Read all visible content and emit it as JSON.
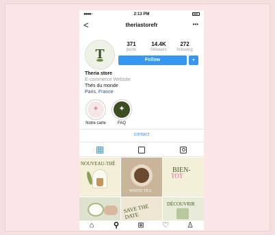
{
  "status_bar": {
    "signal": "●●●●○",
    "time": "2:13 PM"
  },
  "header": {
    "back_icon": "chevron-left-icon",
    "back": "<",
    "username": "theriastorefr",
    "more_icon": "more-icon",
    "more": "•••"
  },
  "profile": {
    "avatar_monogram": "T",
    "stats": [
      {
        "value": "371",
        "label": "posts"
      },
      {
        "value": "14.4K",
        "label": "followers"
      },
      {
        "value": "272",
        "label": "following"
      }
    ],
    "follow_button": "Follow",
    "dropdown_icon": "▾",
    "accent": "#3897f0"
  },
  "bio": {
    "name": "Theria store",
    "category": "E-commerce Website",
    "tagline": "Thés du monde",
    "location": "Paris, France"
  },
  "highlights": [
    {
      "label": "Notre carte",
      "icon": "✦"
    },
    {
      "label": "FAQ",
      "icon": "✦"
    }
  ],
  "contact_button": "contact",
  "tabs": [
    {
      "name": "grid-icon",
      "active": true
    },
    {
      "name": "feed-icon",
      "active": false
    },
    {
      "name": "tagged-icon",
      "active": false
    }
  ],
  "posts": [
    {
      "text": "NOUVEAU-THÉ"
    },
    {
      "text": "WHITE TEA"
    },
    {
      "text": "BIEN-",
      "text2": "TOT"
    },
    {
      "text": ""
    },
    {
      "text": "SAVE THE DATE"
    },
    {
      "text": "DÉCOUVRIR"
    }
  ],
  "bottom_nav": [
    {
      "name": "home-icon",
      "glyph": "⌂"
    },
    {
      "name": "search-icon",
      "glyph": "⚲"
    },
    {
      "name": "add-post-icon",
      "glyph": "⊞"
    },
    {
      "name": "heart-icon",
      "glyph": "♡"
    },
    {
      "name": "profile-icon",
      "glyph": "♙"
    }
  ]
}
